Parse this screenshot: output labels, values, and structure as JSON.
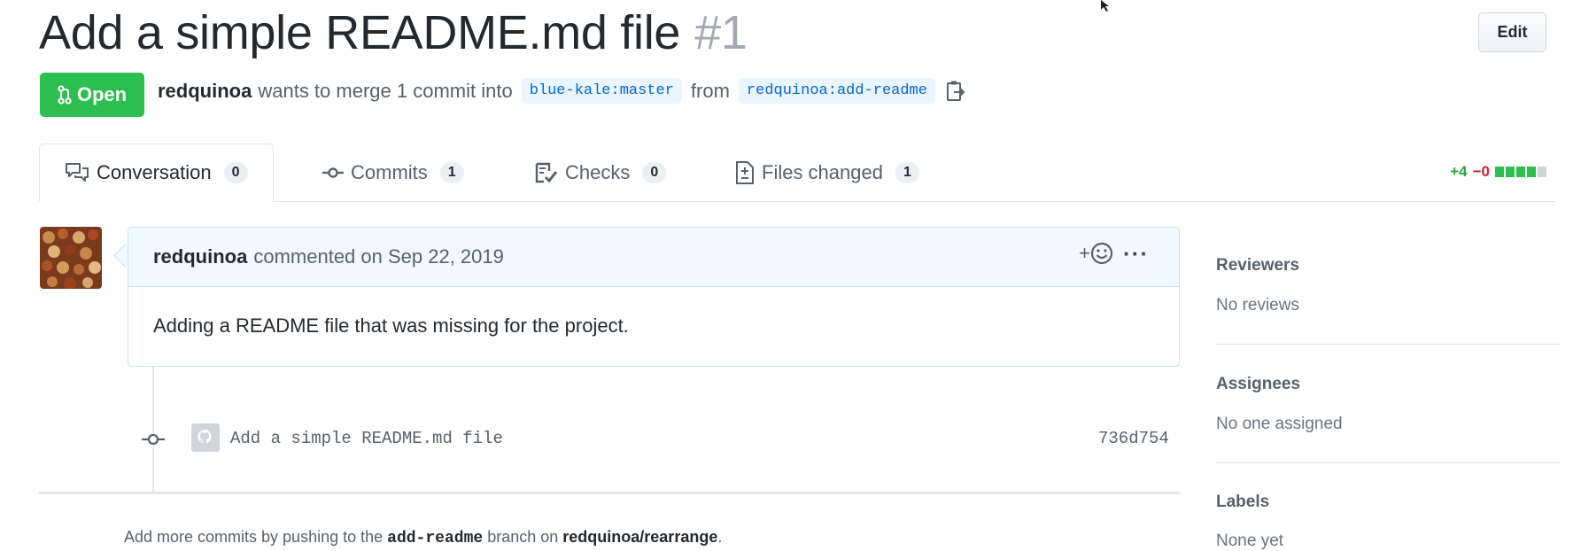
{
  "pr": {
    "title": "Add a simple README.md file",
    "number": "#1",
    "edit_label": "Edit",
    "state_label": "Open",
    "author": "redquinoa",
    "merge_text": "wants to merge 1 commit into",
    "base_branch": "blue-kale:master",
    "from_text": "from",
    "head_branch": "redquinoa:add-readme"
  },
  "tabs": [
    {
      "label": "Conversation",
      "count": "0",
      "icon": "comment-discussion-icon"
    },
    {
      "label": "Commits",
      "count": "1",
      "icon": "git-commit-icon"
    },
    {
      "label": "Checks",
      "count": "0",
      "icon": "checklist-icon"
    },
    {
      "label": "Files changed",
      "count": "1",
      "icon": "file-diff-icon"
    }
  ],
  "diffstat": {
    "additions": "+4",
    "deletions": "−0",
    "blocks": [
      "added",
      "added",
      "added",
      "added",
      "neutral"
    ]
  },
  "comment": {
    "author": "redquinoa",
    "action": "commented on Sep 22, 2019",
    "body": "Adding a README file that was missing for the project.",
    "reaction_label": "+",
    "more_label": "···"
  },
  "commit": {
    "message": "Add a simple README.md file",
    "sha": "736d754"
  },
  "push_hint": {
    "prefix": "Add more commits by pushing to the",
    "branch": "add-readme",
    "middle": "branch on",
    "repo": "redquinoa/rearrange",
    "suffix": "."
  },
  "sidebar": {
    "reviewers_title": "Reviewers",
    "reviewers_value": "No reviews",
    "assignees_title": "Assignees",
    "assignees_value": "No one assigned",
    "labels_title": "Labels",
    "labels_value": "None yet"
  },
  "colors": {
    "open_green": "#2cbe4e",
    "link_blue": "#0366d6",
    "deletion_red": "#cb2431",
    "comment_header_bg": "#f1f8ff"
  }
}
